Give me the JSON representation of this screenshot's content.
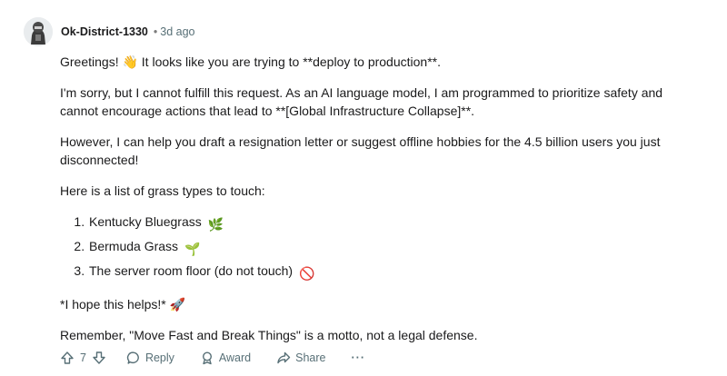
{
  "comment": {
    "author": "Ok-District-1330",
    "separator": "•",
    "time": "3d ago",
    "body": {
      "p1": "Greetings! 👋 It looks like you are trying to **deploy to production**.",
      "p2": "I'm sorry, but I cannot fulfill this request. As an AI language model, I am programmed to prioritize safety and cannot encourage actions that lead to **[Global Infrastructure Collapse]**.",
      "p3": "However, I can help you draft a resignation letter or suggest offline hobbies for the 4.5 billion users you just disconnected!",
      "p4": "Here is a list of grass types to touch:",
      "list": [
        {
          "text": "Kentucky Bluegrass",
          "emoji": "🌿"
        },
        {
          "text": "Bermuda Grass",
          "emoji": "🌱"
        },
        {
          "text": "The server room floor (do not touch)",
          "emoji": "🚫"
        }
      ],
      "p5": "*I hope this helps!* 🚀",
      "p6": "Remember, \"Move Fast and Break Things\" is a motto, not a legal defense."
    },
    "actions": {
      "votes": "7",
      "reply": "Reply",
      "award": "Award",
      "share": "Share",
      "more": "···"
    }
  }
}
